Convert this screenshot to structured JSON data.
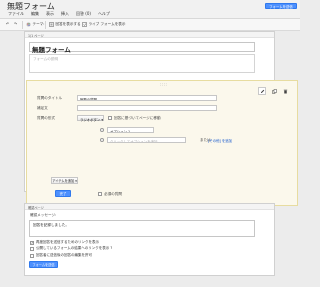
{
  "app": {
    "title": "無題フォーム",
    "menu": [
      "ファイル",
      "編集",
      "表示",
      "挿入",
      "回答 (0)",
      "ヘルプ"
    ],
    "save_label": "フォームを送信"
  },
  "toolbar": {
    "undo_icon": "↶",
    "redo_icon": "↷",
    "theme_label": "テーマ:",
    "view_responses_label": "回答を表示する",
    "live_form_label": "ライブ フォームを表示"
  },
  "page1": {
    "header": "1/1 ページ",
    "title_value": "無題フォーム",
    "description_placeholder": "フォームの説明"
  },
  "question": {
    "handle": "::::",
    "title_label": "質問のタイトル",
    "title_value": "無題の質問",
    "help_label": "補足文",
    "help_value": "",
    "type_label": "質問の形式",
    "type_value": "ラジオボタン ▾",
    "go_to_page_label": "回答に基づいてページに移動",
    "option1_value": "オプション 1",
    "add_option_placeholder": "クリックしてオプションを追加",
    "or_label": "または",
    "other_link": "[その他] を追加",
    "done_label": "完了",
    "required_label": "必須の質問"
  },
  "add_item": {
    "label": "アイテムを追加 ▾"
  },
  "confirm": {
    "header": "確認ページ",
    "message_label": "確認メッセージ:",
    "message_value": "回答を記録しました。",
    "options": [
      {
        "label": "再度回答を送信するためのリンクを表示",
        "checked": true
      },
      {
        "label": "公開しているフォームの結果へのリンクを表示 ?",
        "checked": false
      },
      {
        "label": "回答者に送信後の回答の編集を許可",
        "checked": false
      }
    ],
    "send_label": "フォームを送信"
  },
  "icons": {
    "edit": "pencil-icon",
    "duplicate": "duplicate-icon",
    "delete": "trash-icon"
  },
  "colors": {
    "accent": "#4d90fe",
    "panel_bg": "#fbf8ec",
    "link": "#1155cc"
  }
}
